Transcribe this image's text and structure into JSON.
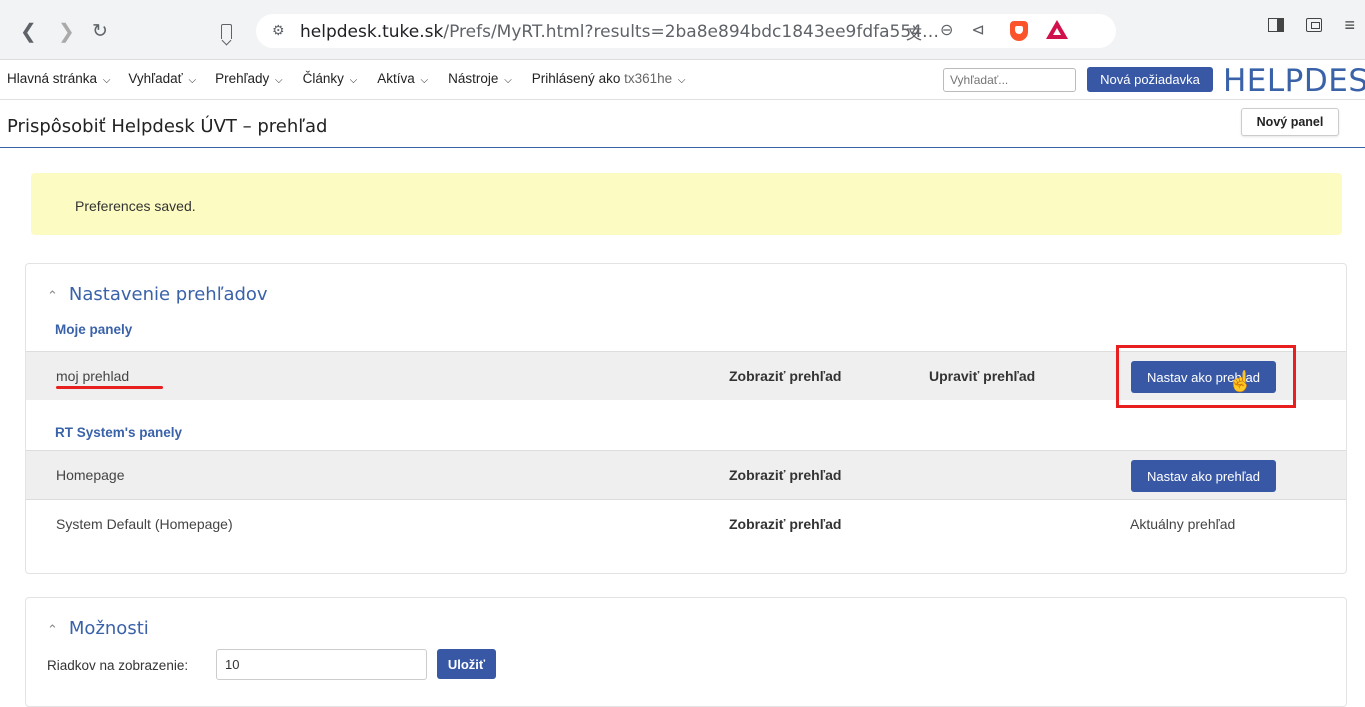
{
  "browser": {
    "url_domain": "helpdesk.tuke.sk",
    "url_path": "/Prefs/MyRT.html?results=2ba8e894bdc1843ee9fdfa554…",
    "icons": [
      "back-icon",
      "forward-icon",
      "reload-icon",
      "bookmark-icon",
      "site-settings-icon",
      "translate-icon",
      "zoom-icon",
      "share-icon",
      "brave-shields-icon",
      "brave-rewards-icon",
      "sidebar-icon",
      "wallet-icon",
      "menu-icon"
    ]
  },
  "rt_nav": {
    "items": [
      {
        "label": "Hlavná stránka"
      },
      {
        "label": "Vyhľadať"
      },
      {
        "label": "Prehľady"
      },
      {
        "label": "Články"
      },
      {
        "label": "Aktíva"
      },
      {
        "label": "Nástroje"
      }
    ],
    "logged_in_label": "Prihlásený ako",
    "username": "tx361he",
    "search_placeholder": "Vyhľadať...",
    "new_ticket_label": "Nová požiadavka",
    "logo": "HELPDESK"
  },
  "page": {
    "title": "Prispôsobiť Helpdesk ÚVT – prehľad",
    "new_panel_label": "Nový panel"
  },
  "alert": {
    "text": "Preferences saved."
  },
  "dashboards": {
    "title": "Nastavenie prehľadov",
    "my_panels_label": "Moje panely",
    "my_panels": [
      {
        "name": "moj prehlad",
        "show": "Zobraziť prehľad",
        "edit": "Upraviť prehľad",
        "action": "Nastav ako prehľad"
      }
    ],
    "system_panels_label": "RT System's panely",
    "system_panels": [
      {
        "name": "Homepage",
        "show": "Zobraziť prehľad",
        "action": "Nastav ako prehľad"
      },
      {
        "name": "System Default (Homepage)",
        "show": "Zobraziť prehľad",
        "status": "Aktuálny prehľad"
      }
    ]
  },
  "options": {
    "title": "Možnosti",
    "rows_label": "Riadkov na zobrazenie:",
    "rows_value": "10",
    "save_label": "Uložiť"
  },
  "colors": {
    "accent": "#3858a6",
    "title_blue": "#3a62a9",
    "alert_bg": "#fcfbc2",
    "annotation_red": "#e81f1f"
  }
}
